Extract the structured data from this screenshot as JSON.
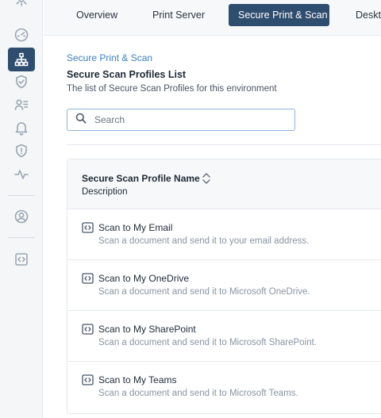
{
  "tabs": [
    {
      "label": "Overview",
      "active": false
    },
    {
      "label": "Print Server",
      "active": false
    },
    {
      "label": "Secure Print & Scan",
      "active": true
    },
    {
      "label": "Deskt",
      "active": false
    }
  ],
  "breadcrumb": "Secure Print & Scan",
  "page": {
    "title": "Secure Scan Profiles List",
    "subtitle": "The list of Secure Scan Profiles for this environment"
  },
  "search": {
    "placeholder": "Search",
    "value": ""
  },
  "table": {
    "columns": {
      "name": "Secure Scan Profile Name",
      "description": "Description"
    },
    "rows": [
      {
        "name": "Scan to My Email",
        "description": "Scan a document and send it to your email address."
      },
      {
        "name": "Scan to My OneDrive",
        "description": "Scan a document and send it to Microsoft OneDrive."
      },
      {
        "name": "Scan to My SharePoint",
        "description": "Scan a document and send it to Microsoft SharePoint."
      },
      {
        "name": "Scan to My Teams",
        "description": "Scan a document and send it to Microsoft Teams."
      }
    ]
  },
  "rail_icons": [
    "settings-icon",
    "dashboard-gauge-icon",
    "network-icon",
    "shield-check-icon",
    "user-list-icon",
    "bell-icon",
    "shield-alert-icon",
    "activity-icon",
    "account-icon",
    "code-box-icon"
  ],
  "colors": {
    "accent": "#2f4d6e",
    "link": "#3d7fc1",
    "focus_border": "#8fb4de"
  }
}
